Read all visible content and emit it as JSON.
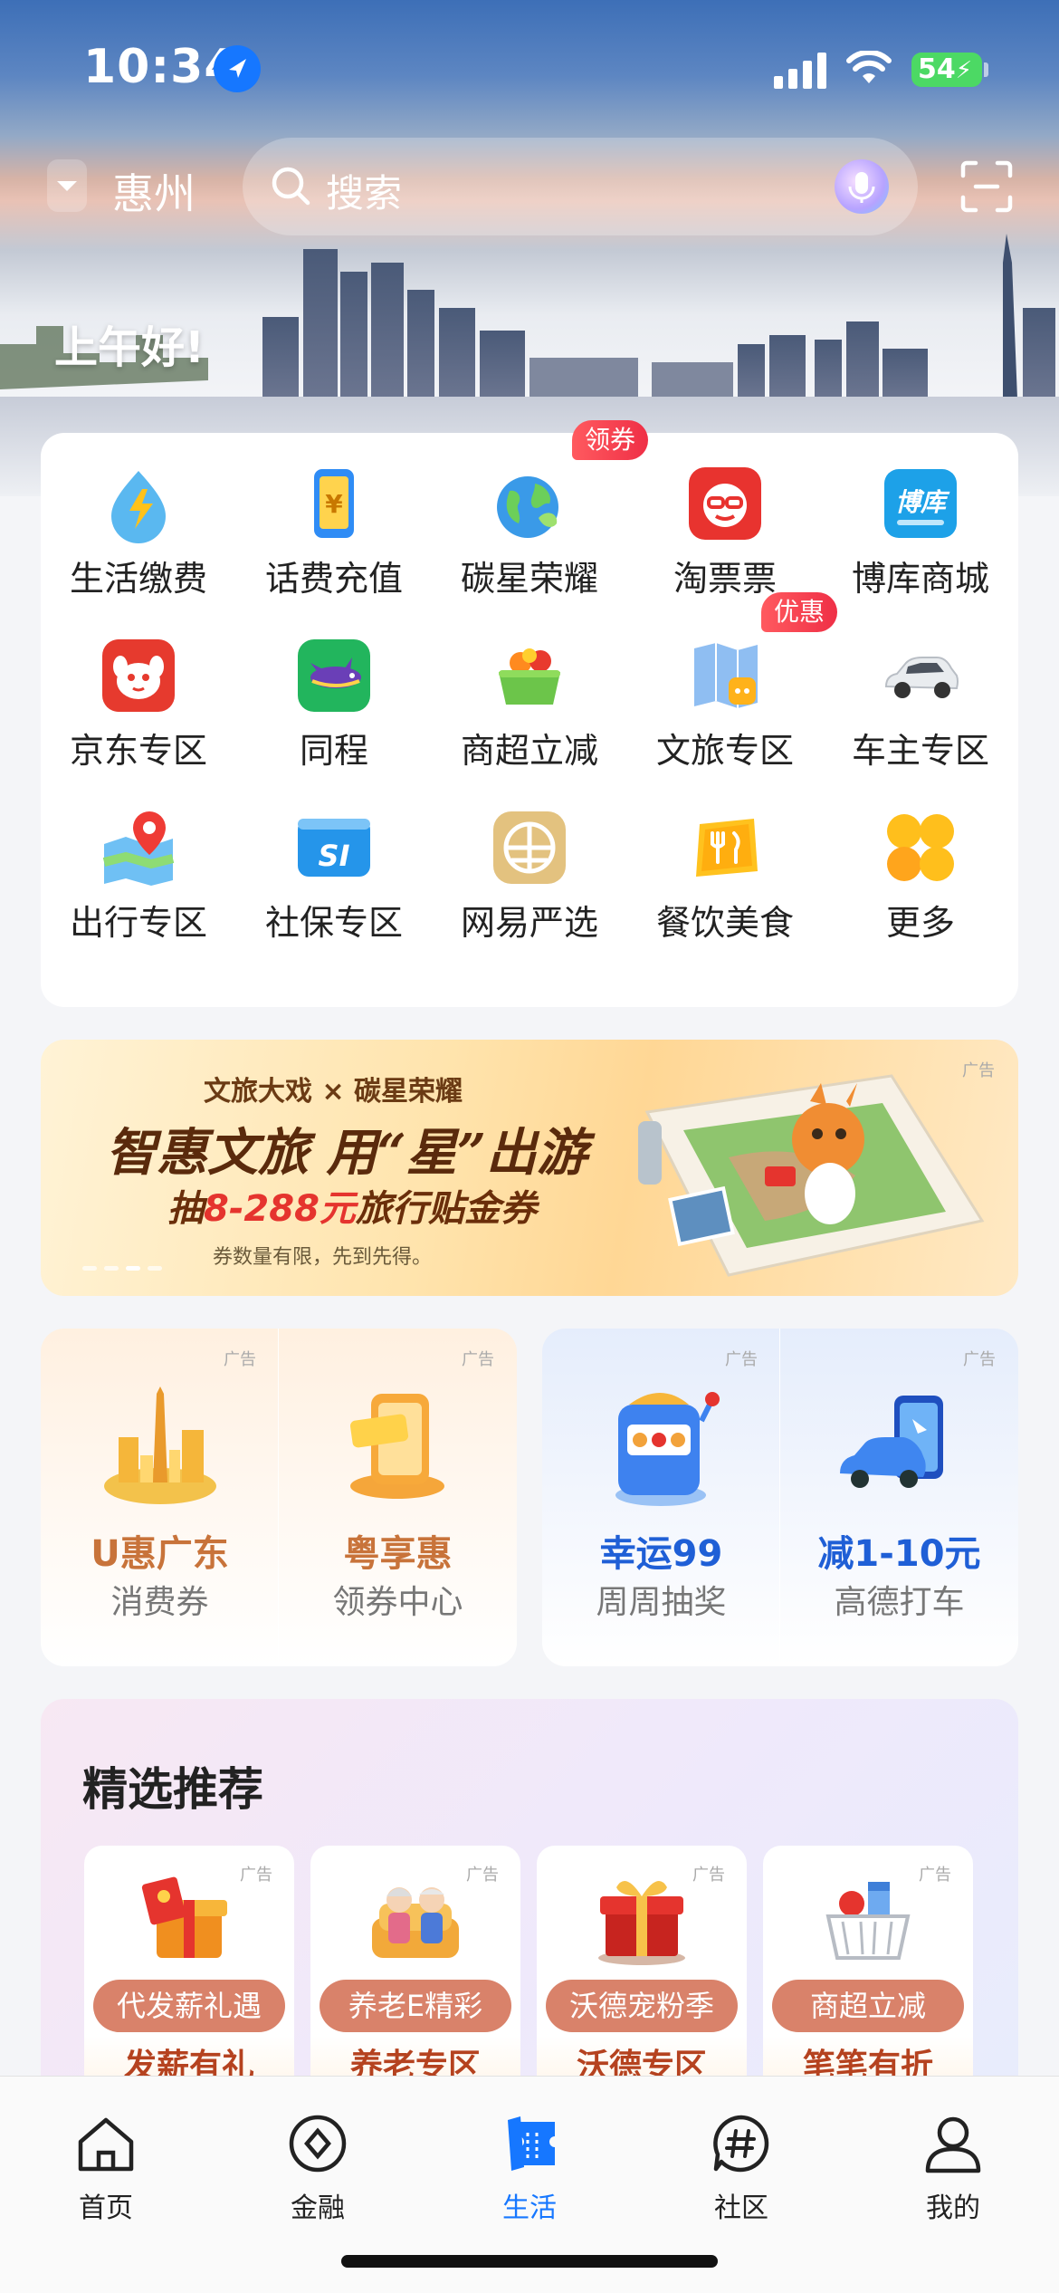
{
  "status": {
    "time": "10:34",
    "battery": "54"
  },
  "header": {
    "city": "惠州",
    "search_placeholder": "搜索",
    "greeting": "上午好!"
  },
  "services": [
    {
      "label": "生活缴费",
      "icon": "utility-payment-icon"
    },
    {
      "label": "话费充值",
      "icon": "phone-recharge-icon"
    },
    {
      "label": "碳星荣耀",
      "icon": "earth-icon",
      "badge": "领券"
    },
    {
      "label": "淘票票",
      "icon": "taopiaopiao-icon"
    },
    {
      "label": "博库商城",
      "icon": "boku-icon",
      "icon_text": "博库"
    },
    {
      "label": "京东专区",
      "icon": "jd-icon"
    },
    {
      "label": "同程",
      "icon": "tongcheng-icon"
    },
    {
      "label": "商超立减",
      "icon": "grocery-basket-icon"
    },
    {
      "label": "文旅专区",
      "icon": "travel-map-icon",
      "badge": "优惠"
    },
    {
      "label": "车主专区",
      "icon": "car-icon"
    },
    {
      "label": "出行专区",
      "icon": "map-pin-icon"
    },
    {
      "label": "社保专区",
      "icon": "social-security-icon",
      "icon_text": "SI"
    },
    {
      "label": "网易严选",
      "icon": "yanxuan-icon"
    },
    {
      "label": "餐饮美食",
      "icon": "dining-icon"
    },
    {
      "label": "更多",
      "icon": "more-grid-icon"
    }
  ],
  "banner": {
    "brand": "文旅大戏 × 碳星荣耀",
    "headline": "智惠文旅 用“星”出游",
    "offer_prefix": "抽",
    "offer_amount": "8-288元",
    "offer_suffix": "旅行贴金券",
    "note": "券数量有限，先到先得。",
    "ad": "广告"
  },
  "promos": [
    {
      "title": "U惠广东",
      "subtitle": "消费券",
      "ad": "广告",
      "color": "#c8733a"
    },
    {
      "title": "粤享惠",
      "subtitle": "领券中心",
      "ad": "广告",
      "color": "#c8733a"
    },
    {
      "title": "幸运99",
      "subtitle": "周周抽奖",
      "ad": "广告",
      "color": "#1f5fd6"
    },
    {
      "title": "减1-10元",
      "subtitle": "高德打车",
      "ad": "广告",
      "color": "#1f5fd6"
    }
  ],
  "featured": {
    "title": "精选推荐",
    "items": [
      {
        "pill": "代发薪礼遇",
        "title": "发薪有礼",
        "ad": "广告"
      },
      {
        "pill": "养老E精彩",
        "title": "养老专区",
        "ad": "广告"
      },
      {
        "pill": "沃德宠粉季",
        "title": "沃德专区",
        "ad": "广告"
      },
      {
        "pill": "商超立减",
        "title": "笔笔有折",
        "ad": "广告"
      }
    ]
  },
  "tabs": [
    {
      "label": "首页",
      "icon": "home-icon"
    },
    {
      "label": "金融",
      "icon": "finance-icon"
    },
    {
      "label": "生活",
      "icon": "life-ticket-icon",
      "active": true
    },
    {
      "label": "社区",
      "icon": "community-hashtag-icon"
    },
    {
      "label": "我的",
      "icon": "profile-icon"
    }
  ],
  "colors": {
    "accent": "#1677ff",
    "badge": "#ef2f46"
  }
}
